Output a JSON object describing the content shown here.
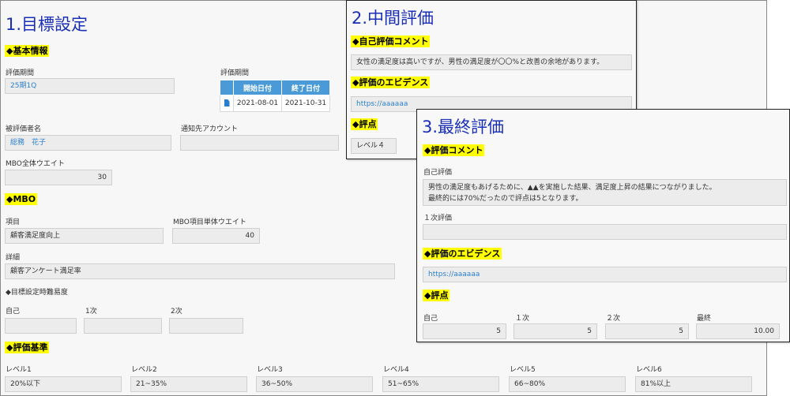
{
  "panel1": {
    "title": "1.目標設定",
    "basic_info": {
      "heading": "◆基本情報",
      "period_label": "評価期間",
      "period_value": "25期1Q",
      "period_table_label": "評価期間",
      "period_table_headers": [
        "開始日付",
        "終了日付"
      ],
      "start_date": "2021-08-01",
      "end_date": "2021-10-31",
      "evaluatee_label": "被評価者名",
      "evaluatee_value": "総務　花子",
      "notify_label": "通知先アカウント",
      "notify_value": "",
      "weight_label": "MBO全体ウエイト",
      "weight_value": "30"
    },
    "mbo": {
      "heading": "◆MBO",
      "item_label": "項目",
      "item_value": "顧客満足度向上",
      "item_weight_label": "MBO項目単体ウエイト",
      "item_weight_value": "40",
      "detail_label": "詳細",
      "detail_value": "顧客アンケート満足率",
      "difficulty_label": "◆目標設定時難易度",
      "self_label": "自己",
      "first_label": "1次",
      "second_label": "2次",
      "self_value": "",
      "first_value": "",
      "second_value": ""
    },
    "criteria": {
      "heading": "◆評価基準",
      "levels": [
        {
          "label": "レベル1",
          "value": "20%以下"
        },
        {
          "label": "レベル2",
          "value": "21~35%"
        },
        {
          "label": "レベル3",
          "value": "36~50%"
        },
        {
          "label": "レベル4",
          "value": "51~65%"
        },
        {
          "label": "レベル5",
          "value": "66~80%"
        },
        {
          "label": "レベル6",
          "value": "81%以上"
        }
      ]
    }
  },
  "panel2": {
    "title": "2.中間評価",
    "self_comment_heading": "◆自己評価コメント",
    "self_comment_value": "女性の満足度は高いですが、男性の満足度が〇〇%と改善の余地があります。",
    "evidence_heading": "◆評価のエビデンス",
    "evidence_value": "https://aaaaaa",
    "score_heading": "◆評点",
    "score_value": "レベル４"
  },
  "panel3": {
    "title": "3.最終評価",
    "comment_heading": "◆評価コメント",
    "self_eval_label": "自己評価",
    "self_eval_line1": "男性の満足度もあげるために、▲▲を実施した結果、満足度上昇の結果につながりました。",
    "self_eval_line2": "最終的には70%だったので評点は5となります。",
    "first_eval_label": "１次評価",
    "first_eval_value": "",
    "evidence_heading": "◆評価のエビデンス",
    "evidence_value": "https://aaaaaa",
    "score_heading": "◆評点",
    "scores": [
      {
        "label": "自己",
        "value": "5"
      },
      {
        "label": "１次",
        "value": "5"
      },
      {
        "label": "２次",
        "value": "5"
      },
      {
        "label": "最終",
        "value": "10.00"
      }
    ]
  }
}
